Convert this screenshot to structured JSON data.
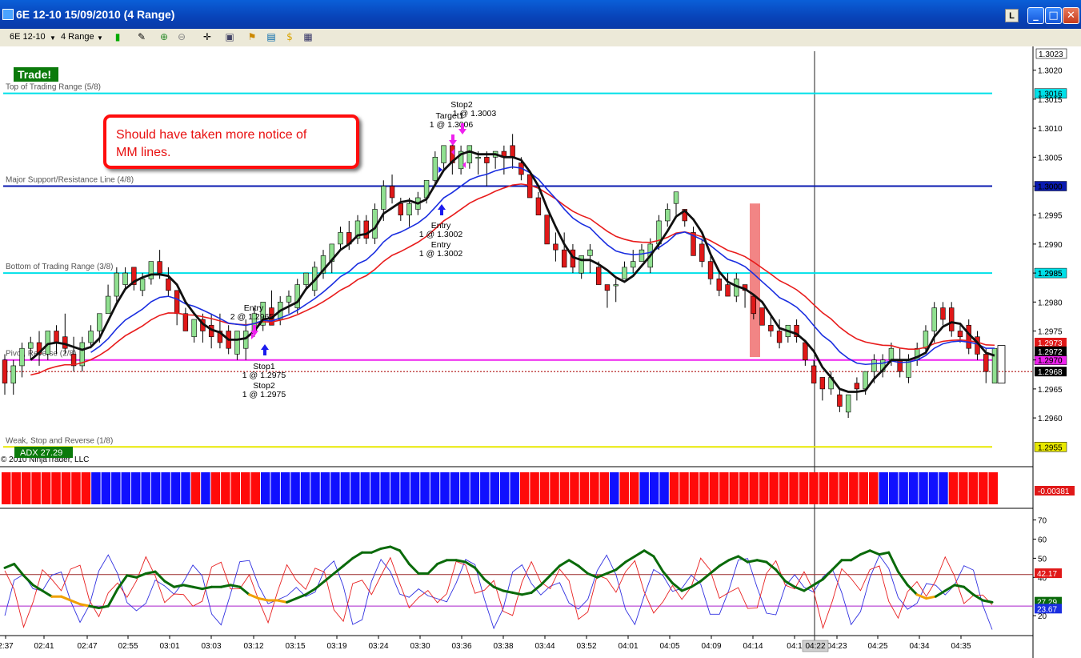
{
  "window": {
    "title": "6E 12-10  15/09/2010 (4 Range)",
    "minimize": "_",
    "maximize": "□",
    "close": "✕",
    "layout_btn": "L"
  },
  "toolbar": {
    "instrument": "6E 12-10",
    "interval": "4 Range",
    "icons": [
      "candlestick-icon",
      "pencil-icon",
      "zoom-in-icon",
      "zoom-out-icon",
      "crosshair-icon",
      "properties-icon",
      "strategies-icon",
      "chart-trader-icon",
      "coin-icon",
      "data-box-icon"
    ]
  },
  "colors": {
    "up": "#90e090",
    "down": "#e01818",
    "sma": "#101010",
    "blue_ma": "#1a2ee0",
    "red_ma": "#e81c1c",
    "cyan": "#00e0e8",
    "navy": "#0a1ab0",
    "magenta": "#ee22ee",
    "yellow": "#e8e800",
    "adx": "#0a6a0a",
    "adx_weak": "#f0a000",
    "dmi_plus": "#3030e0",
    "dmi_minus": "#e82020",
    "brown_line": "#9a2a2a"
  },
  "chart_data": {
    "type": "candlestick",
    "title": "",
    "copyright": "© 2010 NinjaTrader, LLC",
    "trade_badge": "Trade!",
    "price_axis": {
      "ylim": [
        1.2952,
        1.3023
      ],
      "ticks": [
        "1.3020",
        "1.3015",
        "1.3010",
        "1.3005",
        "1.3000",
        "1.2995",
        "1.2990",
        "1.2985",
        "1.2980",
        "1.2975",
        "1.2970",
        "1.2965",
        "1.2960"
      ],
      "top_label": "1.3023"
    },
    "x_ticks": [
      "2:37",
      "02:41",
      "02:47",
      "02:55",
      "03:01",
      "03:03",
      "03:12",
      "03:15",
      "03:19",
      "03:24",
      "03:30",
      "03:36",
      "03:38",
      "03:44",
      "03:52",
      "04:01",
      "04:05",
      "04:09",
      "04:14",
      "04:1",
      "04:23",
      "04:25",
      "04:34",
      "04:35"
    ],
    "cursor_time": "04:22",
    "levels": [
      {
        "name": "Top of Trading Range (5/8)",
        "value": 1.3016,
        "label": "1.3016",
        "color": "#00e0e8"
      },
      {
        "name": "Major Support/Resistance Line (4/8)",
        "value": 1.3,
        "label": "1.3000",
        "color": "#0a1ab0"
      },
      {
        "name": "Bottom of Trading Range (3/8)",
        "value": 1.2985,
        "label": "1.2985",
        "color": "#00e0e8"
      },
      {
        "name": "Pivot, Reverse (2/8)",
        "value": 1.297,
        "label": "1.2970",
        "color": "#ee22ee"
      },
      {
        "name": "Weak, Stop and Reverse (1/8)",
        "value": 1.2955,
        "label": "1.2955",
        "color": "#e8e800"
      }
    ],
    "price_flags": [
      {
        "label": "1.2973",
        "value": 1.2973,
        "color": "#e01818"
      },
      {
        "label": "1.2972",
        "value": 1.29715,
        "color": "#000000"
      },
      {
        "label": "1.2968",
        "value": 1.2968,
        "color": "#000000"
      }
    ],
    "last_price_line": 1.2968,
    "candles": [
      [
        1.297,
        1.2966,
        1.2971,
        1.2964
      ],
      [
        1.2966,
        1.2969,
        1.297,
        1.2964
      ],
      [
        1.2969,
        1.2972,
        1.2973,
        1.2967
      ],
      [
        1.2972,
        1.2973,
        1.2974,
        1.297
      ],
      [
        1.2973,
        1.2971,
        1.2975,
        1.2969
      ],
      [
        1.2971,
        1.2975,
        1.2975,
        1.297
      ],
      [
        1.2975,
        1.2973,
        1.2976,
        1.2971
      ],
      [
        1.2974,
        1.2972,
        1.2978,
        1.2971
      ],
      [
        1.2971,
        1.2969,
        1.2974,
        1.2968
      ],
      [
        1.2969,
        1.2973,
        1.2974,
        1.2968
      ],
      [
        1.2973,
        1.2975,
        1.2976,
        1.2972
      ],
      [
        1.2975,
        1.2978,
        1.2978,
        1.2973
      ],
      [
        1.2978,
        1.2981,
        1.2983,
        1.2978
      ],
      [
        1.2981,
        1.2985,
        1.2986,
        1.298
      ],
      [
        1.2983,
        1.2985,
        1.2986,
        1.2982
      ],
      [
        1.2986,
        1.2983,
        1.2986,
        1.2982
      ],
      [
        1.2982,
        1.2984,
        1.2985,
        1.2981
      ],
      [
        1.2984,
        1.2987,
        1.2987,
        1.2983
      ],
      [
        1.2987,
        1.2985,
        1.2989,
        1.2984
      ],
      [
        1.2984,
        1.2982,
        1.2986,
        1.2981
      ],
      [
        1.2982,
        1.2978,
        1.2982,
        1.2976
      ],
      [
        1.2978,
        1.2975,
        1.2979,
        1.2975
      ],
      [
        1.2974,
        1.2977,
        1.2977,
        1.2973
      ],
      [
        1.2977,
        1.2975,
        1.2978,
        1.2973
      ],
      [
        1.2976,
        1.2974,
        1.2978,
        1.2972
      ],
      [
        1.2975,
        1.2973,
        1.2978,
        1.2972
      ],
      [
        1.2975,
        1.2972,
        1.2976,
        1.2971
      ],
      [
        1.2971,
        1.2975,
        1.2975,
        1.297
      ],
      [
        1.2972,
        1.2975,
        1.2977,
        1.297
      ],
      [
        1.2975,
        1.2978,
        1.2979,
        1.2974
      ],
      [
        1.2976,
        1.298,
        1.298,
        1.2975
      ],
      [
        1.2979,
        1.2976,
        1.2982,
        1.2976
      ],
      [
        1.2977,
        1.298,
        1.2981,
        1.2976
      ],
      [
        1.298,
        1.2981,
        1.2982,
        1.2978
      ],
      [
        1.2979,
        1.2983,
        1.2984,
        1.2978
      ],
      [
        1.2983,
        1.2985,
        1.2985,
        1.2982
      ],
      [
        1.2982,
        1.2986,
        1.2987,
        1.2981
      ],
      [
        1.2985,
        1.2988,
        1.2989,
        1.2984
      ],
      [
        1.2987,
        1.299,
        1.299,
        1.2985
      ],
      [
        1.299,
        1.2992,
        1.2993,
        1.2989
      ],
      [
        1.2992,
        1.299,
        1.2994,
        1.2989
      ],
      [
        1.2991,
        1.2994,
        1.2995,
        1.299
      ],
      [
        1.2994,
        1.2991,
        1.2995,
        1.299
      ],
      [
        1.2991,
        1.2996,
        1.2997,
        1.299
      ],
      [
        1.2996,
        1.3,
        1.3001,
        1.2994
      ],
      [
        1.3,
        1.2998,
        1.3002,
        1.2997
      ],
      [
        1.2997,
        1.2995,
        1.2998,
        1.2994
      ],
      [
        1.2995,
        1.2997,
        1.2998,
        1.2993
      ],
      [
        1.2996,
        1.2998,
        1.2999,
        1.2995
      ],
      [
        1.2998,
        1.3001,
        1.3001,
        1.2997
      ],
      [
        1.3001,
        1.3005,
        1.3006,
        1.3
      ],
      [
        1.3004,
        1.3007,
        1.3007,
        1.3003
      ],
      [
        1.3007,
        1.3004,
        1.3008,
        1.3002
      ],
      [
        1.3003,
        1.3006,
        1.3007,
        1.3002
      ],
      [
        1.3004,
        1.3007,
        1.3007,
        1.3003
      ],
      [
        1.3005,
        1.3005,
        1.3006,
        1.3002
      ],
      [
        1.3005,
        1.3004,
        1.3006,
        1.3
      ],
      [
        1.3005,
        1.3006,
        1.3006,
        1.3003
      ],
      [
        1.3006,
        1.3005,
        1.3007,
        1.3002
      ],
      [
        1.3007,
        1.3005,
        1.3009,
        1.3003
      ],
      [
        1.3004,
        1.3002,
        1.3005,
        1.3001
      ],
      [
        1.3002,
        1.2998,
        1.3002,
        1.2998
      ],
      [
        1.2998,
        1.2995,
        1.2999,
        1.2995
      ],
      [
        1.2995,
        1.299,
        1.2995,
        1.299
      ],
      [
        1.299,
        1.2989,
        1.2992,
        1.2987
      ],
      [
        1.2989,
        1.2986,
        1.2992,
        1.2986
      ],
      [
        1.2989,
        1.2986,
        1.299,
        1.2985
      ],
      [
        1.2985,
        1.2988,
        1.2988,
        1.2984
      ],
      [
        1.2988,
        1.2989,
        1.299,
        1.2985
      ],
      [
        1.2986,
        1.2983,
        1.2987,
        1.2983
      ],
      [
        1.2983,
        1.2982,
        1.2983,
        1.2979
      ],
      [
        1.2983,
        1.2983,
        1.2984,
        1.298
      ],
      [
        1.2984,
        1.2986,
        1.2987,
        1.2984
      ],
      [
        1.2986,
        1.2987,
        1.2989,
        1.2985
      ],
      [
        1.2987,
        1.2989,
        1.299,
        1.2987
      ],
      [
        1.2986,
        1.299,
        1.2991,
        1.2985
      ],
      [
        1.299,
        1.2994,
        1.2995,
        1.2989
      ],
      [
        1.2994,
        1.2996,
        1.2997,
        1.2993
      ],
      [
        1.2997,
        1.2999,
        1.2999,
        1.2995
      ],
      [
        1.2996,
        1.2994,
        1.2996,
        1.2993
      ],
      [
        1.2992,
        1.2988,
        1.2993,
        1.2988
      ],
      [
        1.299,
        1.2987,
        1.2991,
        1.2986
      ],
      [
        1.2987,
        1.2984,
        1.2988,
        1.2983
      ],
      [
        1.2984,
        1.2982,
        1.2985,
        1.2981
      ],
      [
        1.2983,
        1.2981,
        1.2985,
        1.2981
      ],
      [
        1.2981,
        1.2984,
        1.2985,
        1.298
      ],
      [
        1.2983,
        1.2982,
        1.2983,
        1.2979
      ],
      [
        1.2981,
        1.2978,
        1.2981,
        1.2977
      ],
      [
        1.2979,
        1.2976,
        1.2979,
        1.2976
      ],
      [
        1.2976,
        1.2975,
        1.2978,
        1.2974
      ],
      [
        1.2975,
        1.2973,
        1.2977,
        1.2972
      ],
      [
        1.2974,
        1.2976,
        1.2976,
        1.2973
      ],
      [
        1.2976,
        1.2974,
        1.2977,
        1.2973
      ],
      [
        1.2973,
        1.297,
        1.2973,
        1.2969
      ],
      [
        1.2969,
        1.2966,
        1.297,
        1.2966
      ],
      [
        1.2967,
        1.2965,
        1.2967,
        1.2963
      ],
      [
        1.2965,
        1.2967,
        1.2968,
        1.2964
      ],
      [
        1.2964,
        1.2962,
        1.2965,
        1.2961
      ],
      [
        1.2961,
        1.2964,
        1.2964,
        1.296
      ],
      [
        1.2966,
        1.2965,
        1.2967,
        1.2963
      ],
      [
        1.2965,
        1.2968,
        1.2968,
        1.2964
      ],
      [
        1.2968,
        1.297,
        1.2971,
        1.2966
      ],
      [
        1.2968,
        1.297,
        1.2971,
        1.2967
      ],
      [
        1.297,
        1.2972,
        1.2973,
        1.2969
      ],
      [
        1.297,
        1.2968,
        1.2972,
        1.2967
      ],
      [
        1.2967,
        1.297,
        1.2971,
        1.2966
      ],
      [
        1.297,
        1.2972,
        1.2973,
        1.2969
      ],
      [
        1.2972,
        1.2975,
        1.2976,
        1.2971
      ],
      [
        1.2975,
        1.2979,
        1.298,
        1.2973
      ],
      [
        1.2979,
        1.2977,
        1.298,
        1.2976
      ],
      [
        1.2979,
        1.2975,
        1.298,
        1.2974
      ],
      [
        1.2975,
        1.2974,
        1.2976,
        1.2973
      ],
      [
        1.2976,
        1.2972,
        1.2977,
        1.2971
      ],
      [
        1.2974,
        1.2971,
        1.2975,
        1.297
      ],
      [
        1.2971,
        1.2968,
        1.2972,
        1.2966
      ],
      [
        1.2966,
        1.2972,
        1.2972,
        1.2966
      ]
    ],
    "signals": {
      "entry_long_1": {
        "label": "Entry",
        "sub": "2 @ 1.2965"
      },
      "stop1": {
        "label": "Stop1",
        "sub": "1 @ 1.2975"
      },
      "stop2_low": {
        "label": "Stop2",
        "sub": "1 @ 1.2975"
      },
      "entry_1": {
        "label": "Entry",
        "sub": "1 @ 1.3002"
      },
      "entry_2": {
        "label": "Entry",
        "sub": "1 @ 1.3002"
      },
      "stop2_high": {
        "label": "Stop2",
        "sub": "1 @ 1.3003"
      },
      "target1": {
        "label": "Target1",
        "sub": "1 @ 1.3006"
      }
    },
    "annotation": {
      "text": [
        "Should have taken more notice of",
        "MM lines."
      ]
    },
    "adx_badge": "ADX 27.29",
    "histogram": {
      "label": "-0.00381",
      "colors": [
        "R",
        "R",
        "R",
        "R",
        "R",
        "R",
        "R",
        "R",
        "R",
        "B",
        "B",
        "B",
        "B",
        "B",
        "B",
        "B",
        "B",
        "B",
        "B",
        "R",
        "B",
        "R",
        "R",
        "R",
        "R",
        "R",
        "B",
        "B",
        "B",
        "B",
        "B",
        "B",
        "B",
        "B",
        "B",
        "B",
        "B",
        "B",
        "B",
        "B",
        "B",
        "B",
        "B",
        "B",
        "B",
        "B",
        "B",
        "B",
        "B",
        "B",
        "B",
        "B",
        "R",
        "R",
        "R",
        "R",
        "R",
        "R",
        "R",
        "R",
        "R",
        "B",
        "R",
        "R",
        "B",
        "B",
        "B",
        "R",
        "R",
        "R",
        "R",
        "R",
        "R",
        "R",
        "R",
        "R",
        "R",
        "R",
        "R",
        "R",
        "R",
        "R",
        "R",
        "R",
        "R",
        "R",
        "R",
        "R",
        "B",
        "B",
        "B",
        "B",
        "B",
        "B",
        "B",
        "R",
        "R",
        "R",
        "R",
        "R"
      ]
    },
    "adx_panel": {
      "ticks": [
        "70",
        "60",
        "50",
        "40",
        "20"
      ],
      "ylim": [
        10,
        74
      ],
      "flags": [
        {
          "label": "42.17",
          "value": 42.17,
          "color": "#e01818"
        },
        {
          "label": "27.29",
          "value": 27.29,
          "color": "#0a6a0a"
        },
        {
          "label": "23.67",
          "value": 23.67,
          "color": "#1a2ee0"
        }
      ],
      "h_lines": [
        {
          "value": 41.5,
          "color": "#9a2a2a"
        },
        {
          "value": 25,
          "color": "#aa22cc"
        }
      ],
      "adx": [
        45,
        47,
        41,
        36,
        33,
        30,
        30,
        28,
        26,
        25,
        24,
        25,
        34,
        41,
        40,
        42,
        43,
        38,
        35,
        36,
        35,
        34,
        35,
        35,
        36,
        35,
        31,
        29,
        28,
        28,
        27,
        29,
        31,
        34,
        38,
        42,
        46,
        50,
        53,
        53,
        55,
        56,
        54,
        47,
        42,
        42,
        47,
        49,
        49,
        48,
        45,
        39,
        35,
        33,
        32,
        31,
        32,
        36,
        41,
        46,
        49,
        46,
        42,
        40,
        42,
        44,
        48,
        51,
        54,
        51,
        43,
        37,
        33,
        35,
        38,
        42,
        46,
        49,
        51,
        48,
        49,
        48,
        44,
        38,
        35,
        33,
        36,
        39,
        44,
        49,
        49,
        52,
        54,
        52,
        53,
        43,
        36,
        31,
        29,
        30,
        33,
        36,
        35,
        31,
        28,
        27
      ]
    }
  }
}
